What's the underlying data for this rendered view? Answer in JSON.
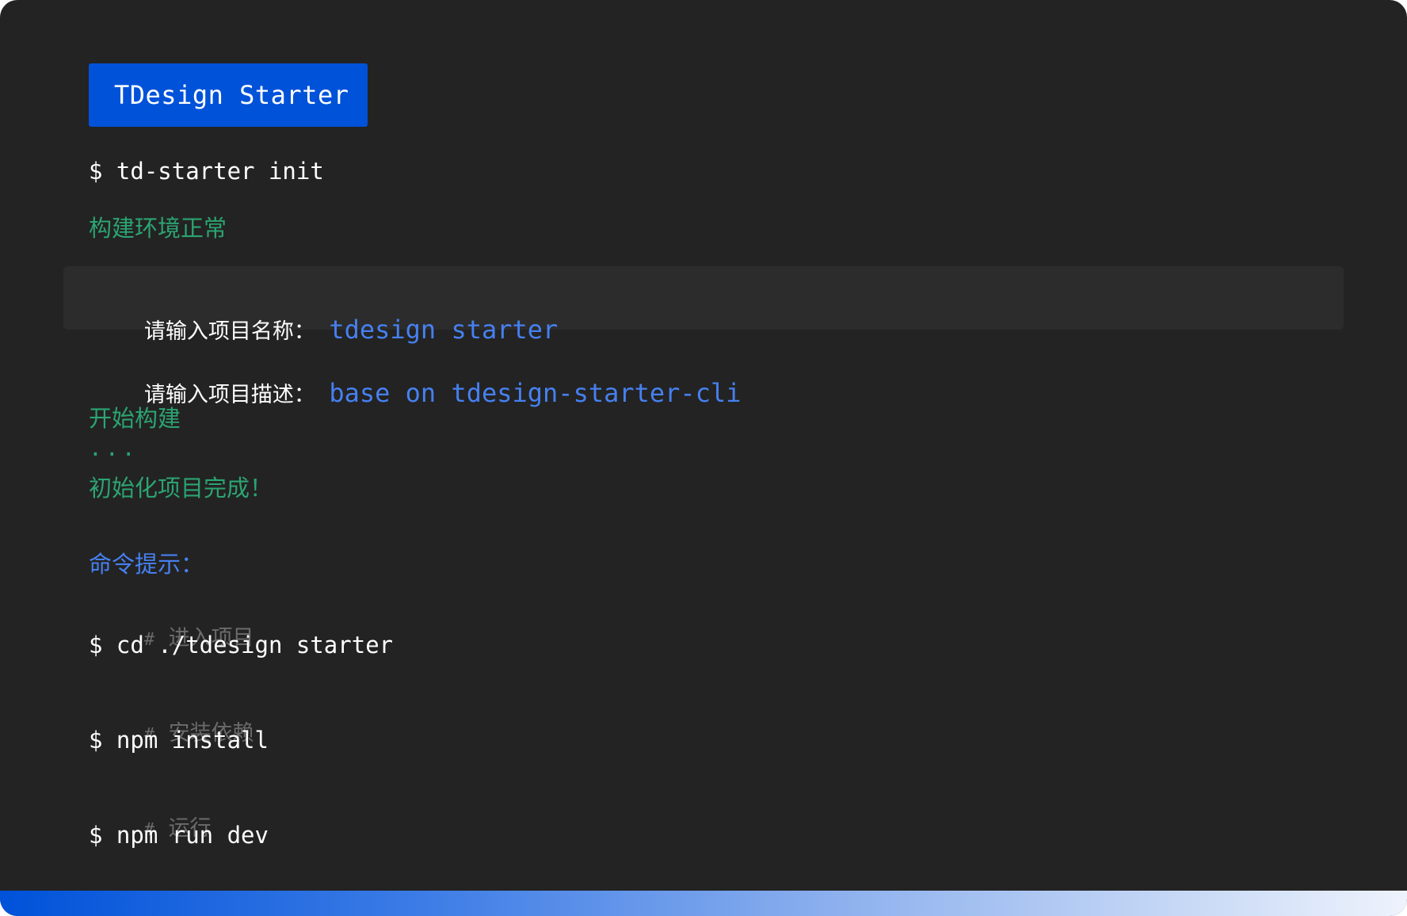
{
  "header": {
    "badge_label": "TDesign Starter"
  },
  "terminal": {
    "init_command": "$ td-starter init",
    "env_ok": "构建环境正常",
    "name_prompt": {
      "label": "请输入项目名称：",
      "value": "tdesign starter"
    },
    "desc_prompt": {
      "label": "请输入项目描述：",
      "value": "base on tdesign-starter-cli"
    },
    "build_start": "开始构建",
    "progress_dots": "...",
    "init_done": "初始化项目完成！",
    "hint_title": "命令提示：",
    "steps": [
      {
        "comment_hash": "#",
        "comment": "进入项目",
        "command": "$ cd ./tdesign starter"
      },
      {
        "comment_hash": "#",
        "comment": "安装依赖",
        "command": "$ npm install"
      },
      {
        "comment_hash": "#",
        "comment": "运行",
        "command": "$ npm run dev"
      }
    ]
  },
  "colors": {
    "background": "#232323",
    "brand": "#0052d9",
    "success": "#2ba471",
    "link": "#4680f0",
    "comment": "#6b6b6b"
  }
}
